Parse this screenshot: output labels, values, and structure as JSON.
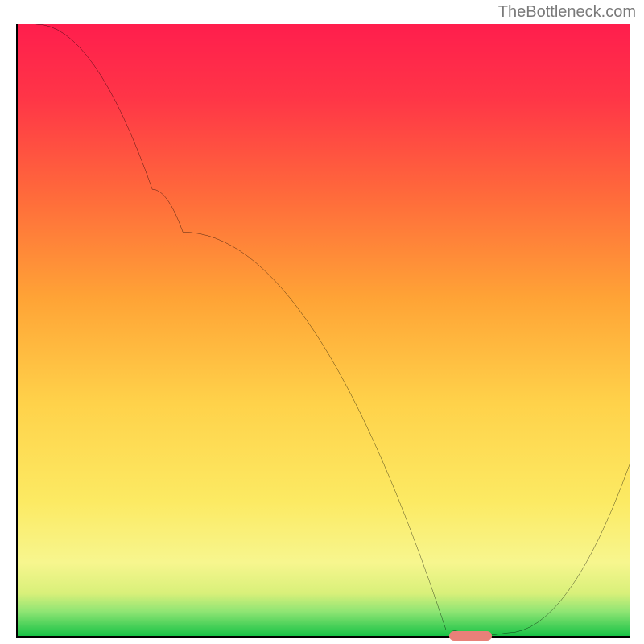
{
  "watermark": "TheBottleneck.com",
  "chart_data": {
    "type": "line",
    "title": "",
    "xlabel": "",
    "ylabel": "",
    "xlim": [
      0,
      100
    ],
    "ylim": [
      0,
      100
    ],
    "grid": false,
    "annotations": [],
    "legend": [],
    "background_gradient": [
      "#ff2a4f",
      "#ff5a3c",
      "#ffa136",
      "#ffd64a",
      "#fbec6a",
      "#f6f797",
      "#7fe37a",
      "#1cc24a"
    ],
    "curve_points": [
      {
        "x": 3,
        "y": 100
      },
      {
        "x": 22,
        "y": 73
      },
      {
        "x": 27,
        "y": 66
      },
      {
        "x": 70,
        "y": 1
      },
      {
        "x": 74,
        "y": 0
      },
      {
        "x": 80,
        "y": 0.5
      },
      {
        "x": 100,
        "y": 28
      }
    ],
    "marker": {
      "x": 74,
      "width": 7,
      "color": "#e98079"
    }
  }
}
